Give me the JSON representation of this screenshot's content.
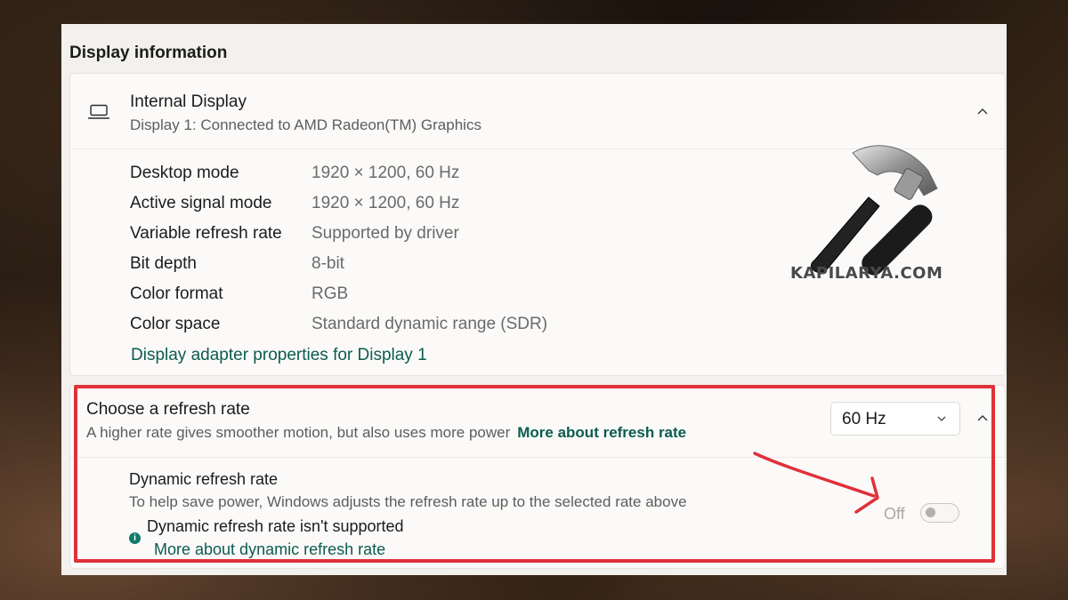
{
  "section_title": "Display information",
  "display_card": {
    "title": "Internal Display",
    "subtitle": "Display 1: Connected to AMD Radeon(TM) Graphics",
    "icon": "laptop-icon",
    "properties": [
      {
        "label": "Desktop mode",
        "value": "1920 × 1200, 60 Hz"
      },
      {
        "label": "Active signal mode",
        "value": "1920 × 1200, 60 Hz"
      },
      {
        "label": "Variable refresh rate",
        "value": "Supported by driver"
      },
      {
        "label": "Bit depth",
        "value": "8-bit"
      },
      {
        "label": "Color format",
        "value": "RGB"
      },
      {
        "label": "Color space",
        "value": "Standard dynamic range (SDR)"
      }
    ],
    "adapter_link": "Display adapter properties for Display 1"
  },
  "refresh_card": {
    "title": "Choose a refresh rate",
    "subtitle": "A higher rate gives smoother motion, but also uses more power",
    "more_link": "More about refresh rate",
    "selected_rate": "60 Hz",
    "dynamic": {
      "title": "Dynamic refresh rate",
      "subtitle": "To help save power, Windows adjusts the refresh rate up to the selected rate above",
      "warning": "Dynamic refresh rate isn't supported",
      "warning_link": "More about dynamic refresh rate",
      "toggle_label": "Off",
      "toggle_state": "off"
    }
  },
  "watermark": {
    "text": "KAPILARYA.COM",
    "icon": "hammer-icon"
  },
  "colors": {
    "link": "#0b5c4e",
    "highlight": "#e0313a",
    "info_dot": "#0f7b6c"
  }
}
